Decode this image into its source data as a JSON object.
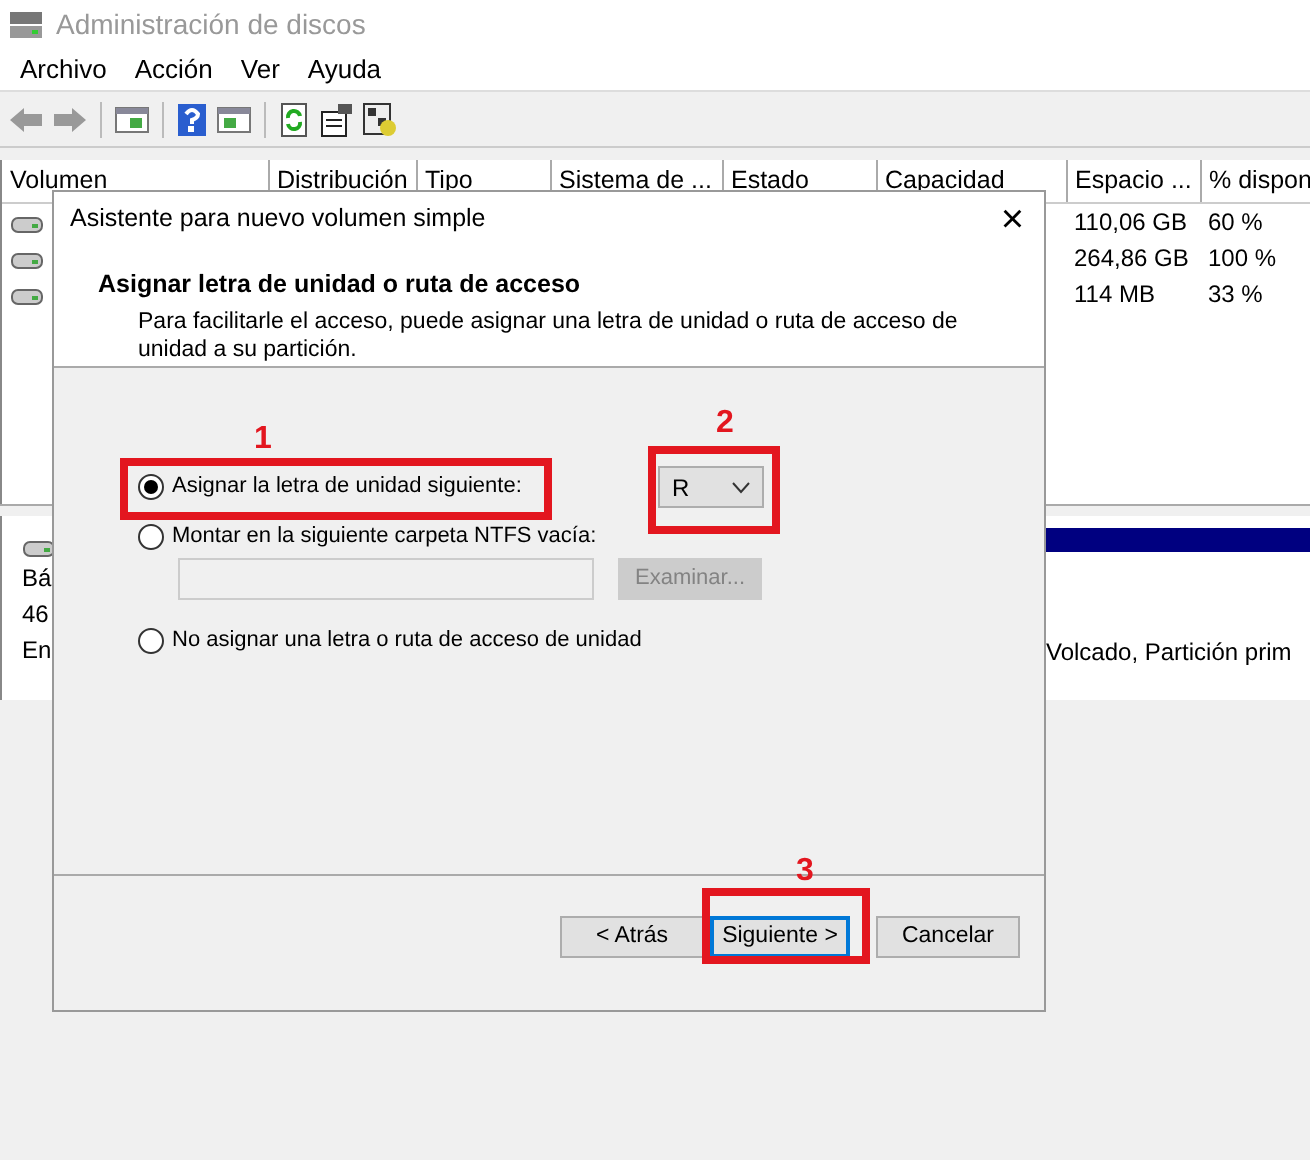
{
  "window": {
    "title": "Administración de discos"
  },
  "menu": [
    "Archivo",
    "Acción",
    "Ver",
    "Ayuda"
  ],
  "table": {
    "columns": [
      "Volumen",
      "Distribución",
      "Tipo",
      "Sistema de ...",
      "Estado",
      "Capacidad",
      "Espacio ...",
      "% dispon"
    ],
    "rows": [
      {
        "free": "110,06 GB",
        "percent": "60 %"
      },
      {
        "free": "264,86 GB",
        "percent": "100 %"
      },
      {
        "free": "114 MB",
        "percent": "33 %"
      }
    ]
  },
  "disk_pane": {
    "lines": [
      "Bá",
      "46",
      "En"
    ],
    "partition_text": "Volcado, Partición prim"
  },
  "dialog": {
    "title": "Asistente para nuevo volumen simple",
    "close": "×",
    "heading": "Asignar letra de unidad o ruta de acceso",
    "description": "Para facilitarle el acceso, puede asignar una letra de unidad o ruta de acceso de unidad a su partición.",
    "options": [
      {
        "label": "Asignar la letra de unidad siguiente:",
        "selected": true
      },
      {
        "label": "Montar en la siguiente carpeta NTFS vacía:",
        "selected": false
      },
      {
        "label": "No asignar una letra o ruta de acceso de unidad",
        "selected": false
      }
    ],
    "drive_letter": "R",
    "folder_field": {
      "disabled": true
    },
    "browse_button": {
      "label": "Examinar...",
      "disabled": true
    },
    "buttons": [
      {
        "label": "< Atrás",
        "default": false
      },
      {
        "label": "Siguiente >",
        "default": true
      },
      {
        "label": "Cancelar",
        "default": false
      }
    ]
  },
  "annotations": [
    {
      "number": "1"
    },
    {
      "number": "2"
    },
    {
      "number": "3"
    }
  ]
}
